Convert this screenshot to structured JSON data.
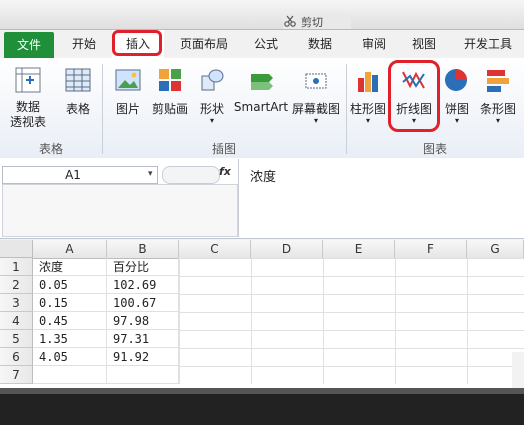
{
  "topbar": {
    "cut_label": "剪切"
  },
  "tabs": [
    {
      "label": "文件"
    },
    {
      "label": "开始"
    },
    {
      "label": "插入"
    },
    {
      "label": "页面布局"
    },
    {
      "label": "公式"
    },
    {
      "label": "数据"
    },
    {
      "label": "审阅"
    },
    {
      "label": "视图"
    },
    {
      "label": "开发工具"
    }
  ],
  "ribbon": {
    "groups": {
      "tables": "表格",
      "illustrations": "插图",
      "charts": "图表"
    },
    "buttons": {
      "pivot": "数据\n透视表",
      "table": "表格",
      "picture": "图片",
      "clipart": "剪贴画",
      "shapes": "形状",
      "smartart": "SmartArt",
      "screenshot": "屏幕截图",
      "column": "柱形图",
      "line": "折线图",
      "pie": "饼图",
      "bar": "条形图"
    },
    "colors": {
      "highlight": "#e0202a",
      "file_tab": "#1f8f3a"
    }
  },
  "formula": {
    "namebox": "A1",
    "fx": "fx",
    "content": "浓度"
  },
  "sheet": {
    "columns": [
      "A",
      "B",
      "C",
      "D",
      "E",
      "F",
      "G"
    ],
    "rows": [
      {
        "n": "1",
        "a": "浓度",
        "b": "百分比"
      },
      {
        "n": "2",
        "a": "0.05",
        "b": "102.69"
      },
      {
        "n": "3",
        "a": "0.15",
        "b": "100.67"
      },
      {
        "n": "4",
        "a": "0.45",
        "b": "97.98"
      },
      {
        "n": "5",
        "a": "1.35",
        "b": "97.31"
      },
      {
        "n": "6",
        "a": "4.05",
        "b": "91.92"
      },
      {
        "n": "7",
        "a": "",
        "b": ""
      }
    ]
  }
}
